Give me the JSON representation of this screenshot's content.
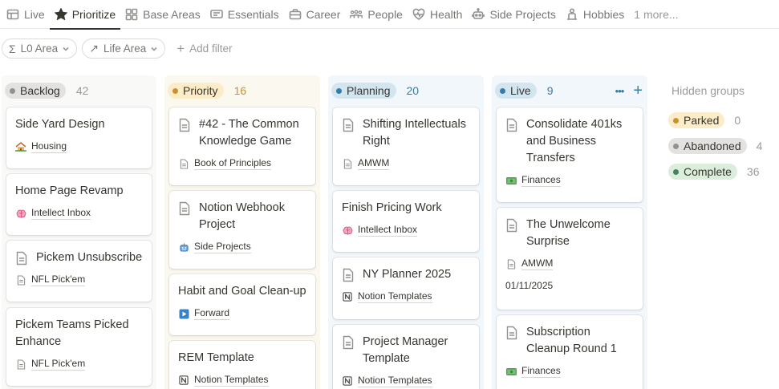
{
  "tabs": [
    {
      "label": "Live",
      "icon": "table-icon",
      "active": false
    },
    {
      "label": "Prioritize",
      "icon": "star-icon",
      "active": true
    },
    {
      "label": "Base Areas",
      "icon": "grid-icon",
      "active": false
    },
    {
      "label": "Essentials",
      "icon": "screen-icon",
      "active": false
    },
    {
      "label": "Career",
      "icon": "briefcase-icon",
      "active": false
    },
    {
      "label": "People",
      "icon": "people-icon",
      "active": false
    },
    {
      "label": "Health",
      "icon": "heart-pulse-icon",
      "active": false
    },
    {
      "label": "Side Projects",
      "icon": "robot-icon",
      "active": false
    },
    {
      "label": "Hobbies",
      "icon": "person-icon",
      "active": false
    }
  ],
  "more_tabs": "1 more...",
  "filters": {
    "l0_area": "L0 Area",
    "l0_glyph": "Σ",
    "life_area": "Life Area",
    "life_glyph": "↗",
    "add_filter": "Add filter"
  },
  "columns": {
    "backlog": {
      "name": "Backlog",
      "count": "42",
      "bg": "#f9f9f8",
      "pill_bg": "#e3e2e0",
      "dot": "#91918e",
      "count_color": "#9b9a97",
      "cards": [
        {
          "title": "Side Yard Design",
          "prop": "Housing",
          "prop_icon": "house-icon"
        },
        {
          "title": "Home Page Revamp",
          "prop": "Intellect Inbox",
          "prop_icon": "brain-icon"
        },
        {
          "title": "Pickem Unsubscribe",
          "prop": "NFL Pick'em",
          "prop_icon": "page-icon"
        },
        {
          "title": "Pickem Teams Picked Enhance",
          "prop": "NFL Pick'em",
          "prop_icon": "page-icon"
        }
      ]
    },
    "priority": {
      "name": "Priority",
      "count": "16",
      "bg": "#fbf8ef",
      "pill_bg": "#fdecc8",
      "dot": "#cb912f",
      "count_color": "#cb912f",
      "cards": [
        {
          "title": "#42 - The Common Knowledge Game",
          "prop": "Book of Principles",
          "prop_icon": "page-icon"
        },
        {
          "title": "Notion Webhook Project",
          "prop": "Side Projects",
          "prop_icon": "robot-icon"
        },
        {
          "title": "Habit and Goal Clean-up",
          "prop": "Forward",
          "prop_icon": "play-button-icon"
        },
        {
          "title": "REM Template",
          "prop": "Notion Templates",
          "prop_icon": "notion-icon"
        }
      ]
    },
    "planning": {
      "name": "Planning",
      "count": "20",
      "bg": "#f2f7fb",
      "pill_bg": "#d3e5ef",
      "dot": "#337ea9",
      "count_color": "#337ea9",
      "cards": [
        {
          "title": "Shifting Intellectuals Right",
          "prop": "AMWM",
          "prop_icon": "page-icon"
        },
        {
          "title": "Finish Pricing Work",
          "prop": "Intellect Inbox",
          "prop_icon": "brain-icon"
        },
        {
          "title": "NY Planner 2025",
          "prop": "Notion Templates",
          "prop_icon": "notion-icon"
        },
        {
          "title": "Project Manager Template",
          "prop": "Notion Templates",
          "prop_icon": "notion-icon"
        }
      ]
    },
    "live": {
      "name": "Live",
      "count": "9",
      "bg": "#f2f7fb",
      "pill_bg": "#d3e5ef",
      "dot": "#337ea9",
      "count_color": "#337ea9",
      "more": "•••",
      "add": "+",
      "cards": [
        {
          "title": "Consolidate 401ks and Business Transfers",
          "prop": "Finances",
          "prop_icon": "money-icon"
        },
        {
          "title": "The Unwelcome Surprise",
          "prop": "AMWM",
          "prop_icon": "page-icon",
          "date": "01/11/2025"
        },
        {
          "title": "Subscription Cleanup Round 1",
          "prop": "Finances",
          "prop_icon": "money-icon"
        }
      ]
    }
  },
  "hidden_groups": {
    "title": "Hidden groups",
    "groups": [
      {
        "name": "Parked",
        "count": "0",
        "pill_bg": "#fdecc8",
        "dot": "#cb912f"
      },
      {
        "name": "Abandoned",
        "count": "4",
        "pill_bg": "#e3e2e0",
        "dot": "#91918e"
      },
      {
        "name": "Complete",
        "count": "36",
        "pill_bg": "#dbeddb",
        "dot": "#448361"
      }
    ]
  }
}
